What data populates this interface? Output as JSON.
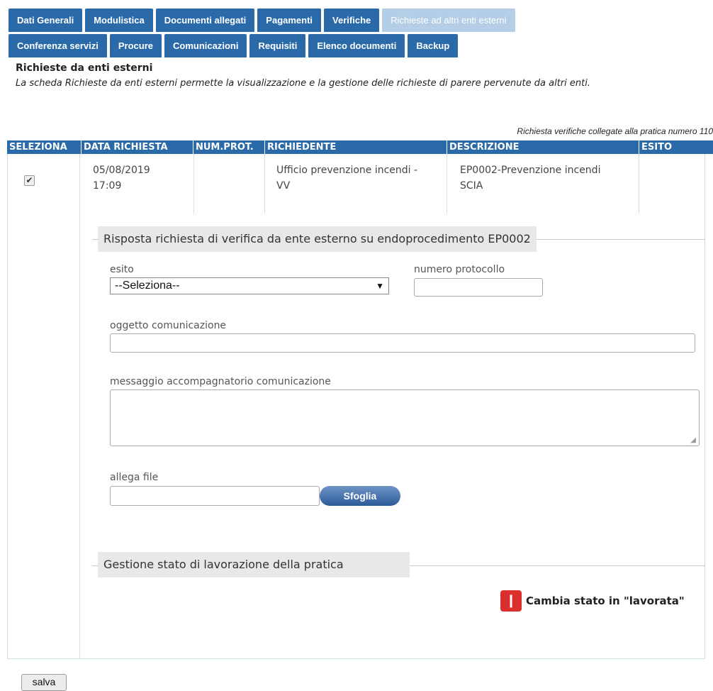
{
  "tabs_row1": [
    "Dati Generali",
    "Modulistica",
    "Documenti allegati",
    "Pagamenti",
    "Verifiche",
    "Richieste ad altri enti esterni"
  ],
  "tabs_row2": [
    "Conferenza servizi",
    "Procure",
    "Comunicazioni",
    "Requisiti",
    "Elenco documenti",
    "Backup"
  ],
  "active_tab": "Richieste ad altri enti esterni",
  "section": {
    "title": "Richieste da enti esterni",
    "description": "La scheda Richieste da enti esterni permette la visualizzazione e la gestione delle richieste di parere pervenute da altri enti."
  },
  "caption": "Richiesta verifiche collegate alla pratica numero 110",
  "table": {
    "headers": [
      "SELEZIONA",
      "DATA RICHIESTA",
      "NUM.PROT.",
      "RICHIEDENTE",
      "DESCRIZIONE",
      "ESITO"
    ],
    "row": {
      "date": "05/08/2019",
      "time": "17:09",
      "prot": "",
      "requester_line1": "Ufficio prevenzione incendi -",
      "requester_line2": "VV",
      "desc_line1": "EP0002-Prevenzione incendi",
      "desc_line2": "SCIA",
      "esito": "",
      "selected": true
    }
  },
  "form": {
    "legend": "Risposta richiesta di verifica da ente esterno su endoprocedimento EP0002",
    "esito_label": "esito",
    "esito_selected": "--Seleziona--",
    "protocol_label": "numero protocollo",
    "subject_label": "oggetto comunicazione",
    "message_label": "messaggio accompagnatorio comunicazione",
    "attach_label": "allega file",
    "browse_label": "Sfoglia"
  },
  "status": {
    "legend": "Gestione stato di lavorazione della pratica",
    "action_label": "Cambia stato in \"lavorata\""
  },
  "save_label": "salva",
  "colors": {
    "tab_blue": "#2a6aa8",
    "tab_active": "#b3cee6",
    "accent_red": "#d9302e"
  }
}
